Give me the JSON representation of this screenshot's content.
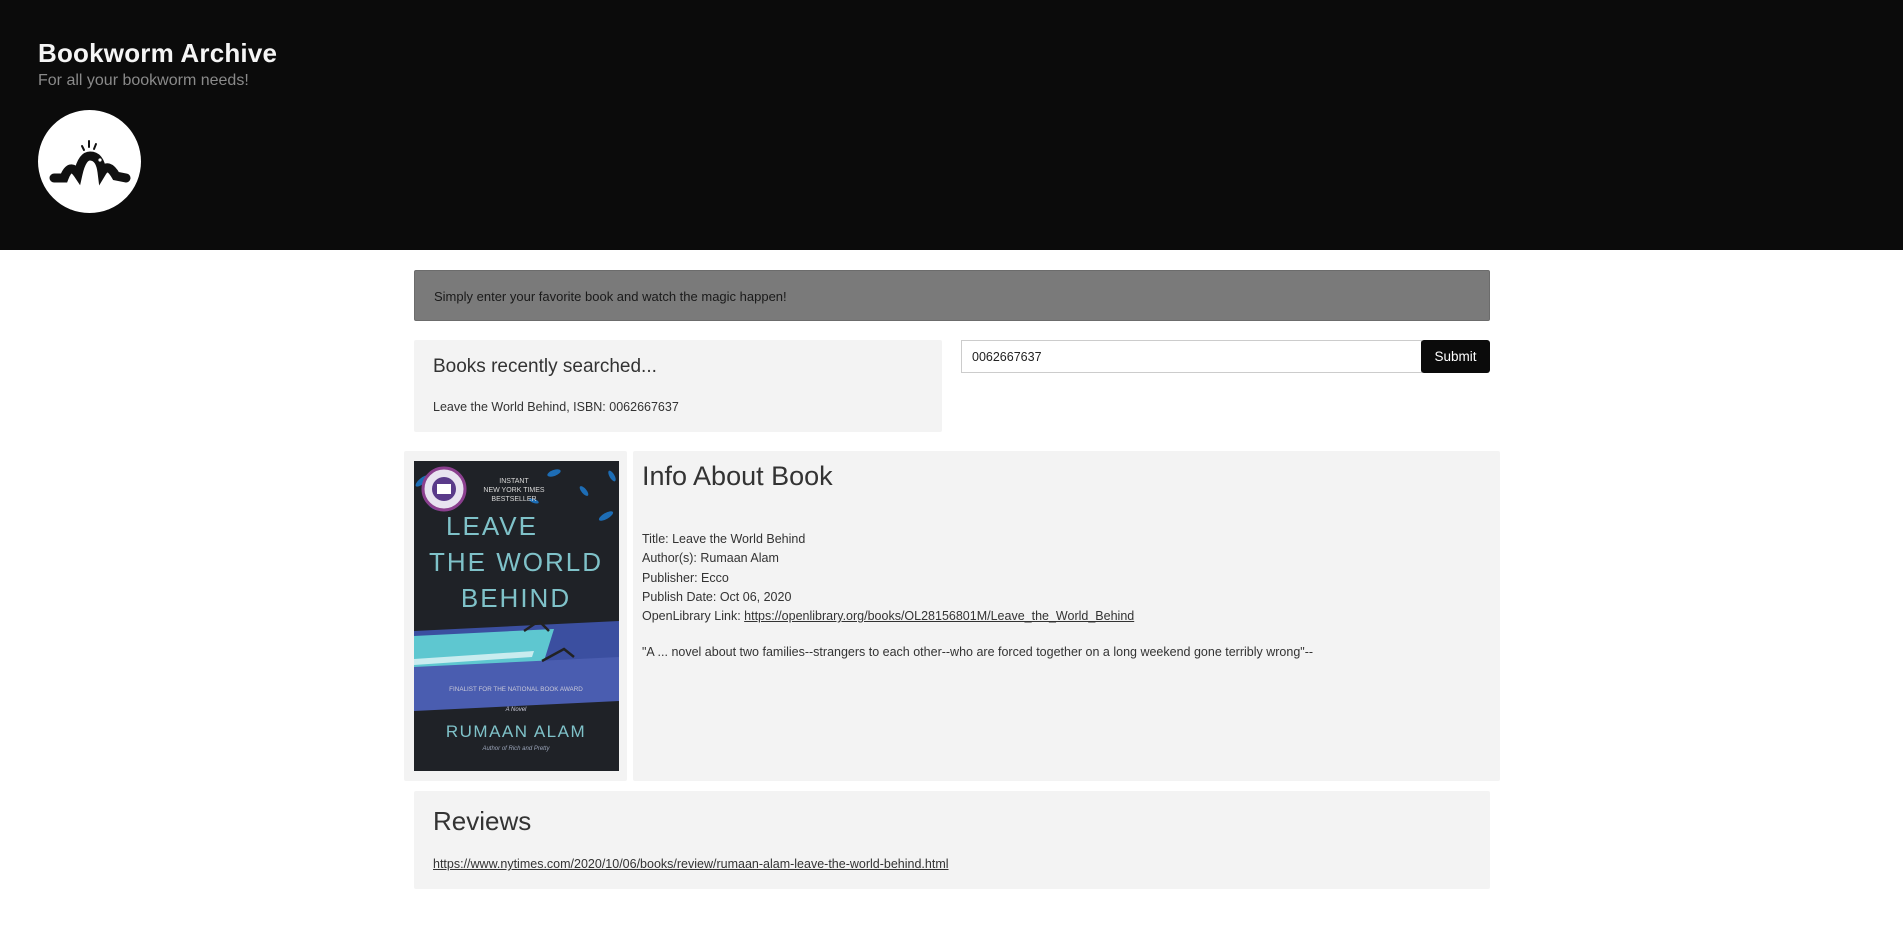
{
  "header": {
    "title": "Bookworm Archive",
    "tagline": "For all your bookworm needs!",
    "logo_icon": "bookworm-logo-icon"
  },
  "banner": {
    "text": "Simply enter your favorite book and watch the magic happen!"
  },
  "recent": {
    "title": "Books recently searched...",
    "items": [
      "Leave the World Behind, ISBN: 0062667637"
    ]
  },
  "search": {
    "value": "0062667637",
    "submit_label": "Submit"
  },
  "cover": {
    "badge_lines": [
      "INSTANT",
      "NEW YORK TIMES",
      "BESTSELLER"
    ],
    "title_lines": [
      "LEAVE",
      "THE WORLD",
      "BEHIND"
    ],
    "finalist": "FINALIST FOR THE NATIONAL BOOK AWARD",
    "subtitle": "A Novel",
    "author": "RUMAAN ALAM",
    "tagline": "Author of Rich and Pretty",
    "colors": {
      "background": "#1f2227",
      "title": "#7fc2c9",
      "pool": "#5ec7d0"
    }
  },
  "info": {
    "title": "Info About Book",
    "book_title": "Title: Leave the World Behind",
    "authors": "Author(s): Rumaan Alam",
    "publisher": "Publisher: Ecco",
    "publish_date": "Publish Date: Oct 06, 2020",
    "link_label": "OpenLibrary Link: ",
    "link_url": "https://openlibrary.org/books/OL28156801M/Leave_the_World_Behind",
    "description": "\"A ... novel about two families--strangers to each other--who are forced together on a long weekend gone terribly wrong\"--"
  },
  "reviews": {
    "title": "Reviews",
    "link": "https://www.nytimes.com/2020/10/06/books/review/rumaan-alam-leave-the-world-behind.html"
  },
  "colors": {
    "header_bg": "#0b0b0b",
    "banner_bg": "#7a7a7a",
    "panel_bg": "#f3f3f3",
    "button_bg": "#0b0b0b"
  }
}
